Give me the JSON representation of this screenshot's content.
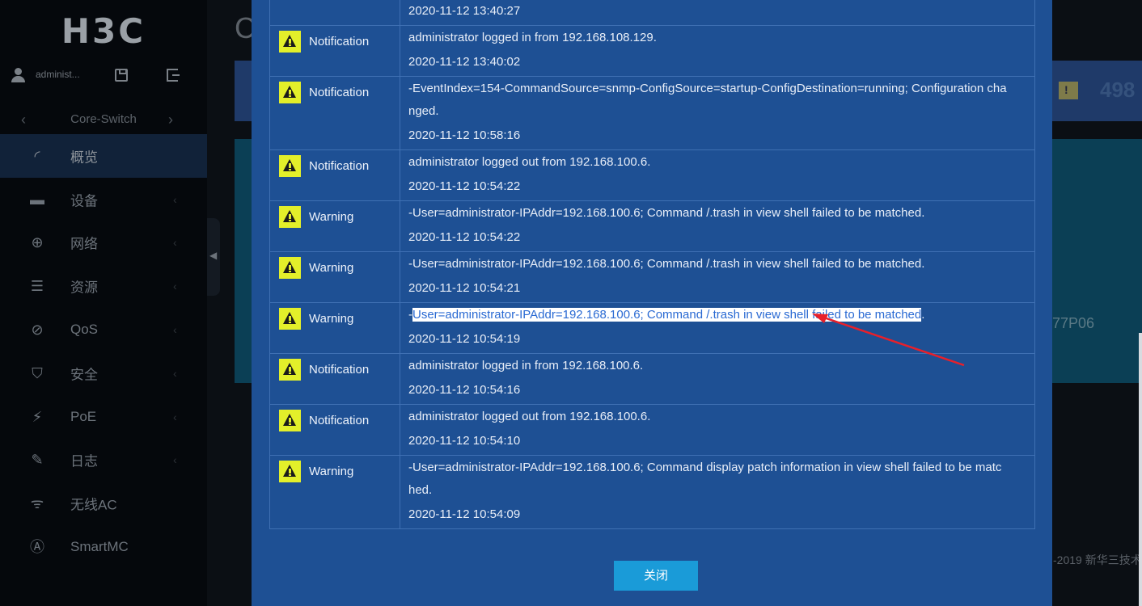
{
  "brand": {
    "logo": "H3C"
  },
  "user": {
    "name": "administ..."
  },
  "device": {
    "name": "Core-Switch"
  },
  "menu": [
    {
      "label": "概览",
      "icon": "dashboard-icon",
      "glyph": "◜",
      "active": true,
      "has_arrow": false
    },
    {
      "label": "设备",
      "icon": "device-icon",
      "glyph": "▬",
      "active": false,
      "has_arrow": true
    },
    {
      "label": "网络",
      "icon": "globe-icon",
      "glyph": "⊕",
      "active": false,
      "has_arrow": true
    },
    {
      "label": "资源",
      "icon": "database-icon",
      "glyph": "☰",
      "active": false,
      "has_arrow": true
    },
    {
      "label": "QoS",
      "icon": "qos-icon",
      "glyph": "⊘",
      "active": false,
      "has_arrow": true
    },
    {
      "label": "安全",
      "icon": "shield-icon",
      "glyph": "⛉",
      "active": false,
      "has_arrow": true
    },
    {
      "label": "PoE",
      "icon": "poe-icon",
      "glyph": "⚡",
      "active": false,
      "has_arrow": true
    },
    {
      "label": "日志",
      "icon": "log-icon",
      "glyph": "✎",
      "active": false,
      "has_arrow": true
    },
    {
      "label": "无线AC",
      "icon": "wifi-icon",
      "glyph": "ᯤ",
      "active": false,
      "has_arrow": false
    },
    {
      "label": "SmartMC",
      "icon": "smartmc-icon",
      "glyph": "Ⓐ",
      "active": false,
      "has_arrow": false
    }
  ],
  "background": {
    "title": "C",
    "alarm_count": "498",
    "model": "77P06",
    "copyright": "-2019 新华三技术"
  },
  "log_dialog": {
    "rows": [
      {
        "type": "",
        "badge": false,
        "lines": [],
        "time": "2020-11-12 13:40:27"
      },
      {
        "type": "Notification",
        "badge": true,
        "lines": [
          "administrator logged in from 192.168.108.129."
        ],
        "time": "2020-11-12 13:40:02"
      },
      {
        "type": "Notification",
        "badge": true,
        "lines": [
          "-EventIndex=154-CommandSource=snmp-ConfigSource=startup-ConfigDestination=running; Configuration cha",
          "nged."
        ],
        "time": "2020-11-12 10:58:16"
      },
      {
        "type": "Notification",
        "badge": true,
        "lines": [
          "administrator logged out from 192.168.100.6."
        ],
        "time": "2020-11-12 10:54:22"
      },
      {
        "type": "Warning",
        "badge": true,
        "lines": [
          "-User=administrator-IPAddr=192.168.100.6; Command /.trash in view shell failed to be matched."
        ],
        "time": "2020-11-12 10:54:22"
      },
      {
        "type": "Warning",
        "badge": true,
        "lines": [
          "-User=administrator-IPAddr=192.168.100.6; Command /.trash in view shell failed to be matched."
        ],
        "time": "2020-11-12 10:54:21"
      },
      {
        "type": "Warning",
        "badge": true,
        "lines": [
          "-User=administrator-IPAddr=192.168.100.6; Command /.trash in view shell failed to be matched."
        ],
        "selected": true,
        "time": "2020-11-12 10:54:19"
      },
      {
        "type": "Notification",
        "badge": true,
        "lines": [
          "administrator logged in from 192.168.100.6."
        ],
        "time": "2020-11-12 10:54:16"
      },
      {
        "type": "Notification",
        "badge": true,
        "lines": [
          "administrator logged out from 192.168.100.6."
        ],
        "time": "2020-11-12 10:54:10"
      },
      {
        "type": "Warning",
        "badge": true,
        "lines": [
          "-User=administrator-IPAddr=192.168.100.6; Command display patch information in view shell failed to be matc",
          "hed."
        ],
        "time": "2020-11-12 10:54:09"
      }
    ],
    "close_label": "关闭"
  },
  "colors": {
    "modal_bg": "#1e5094",
    "badge": "#e3ef2a",
    "close_button": "#1a9bd8",
    "arrow": "#e8202a"
  }
}
